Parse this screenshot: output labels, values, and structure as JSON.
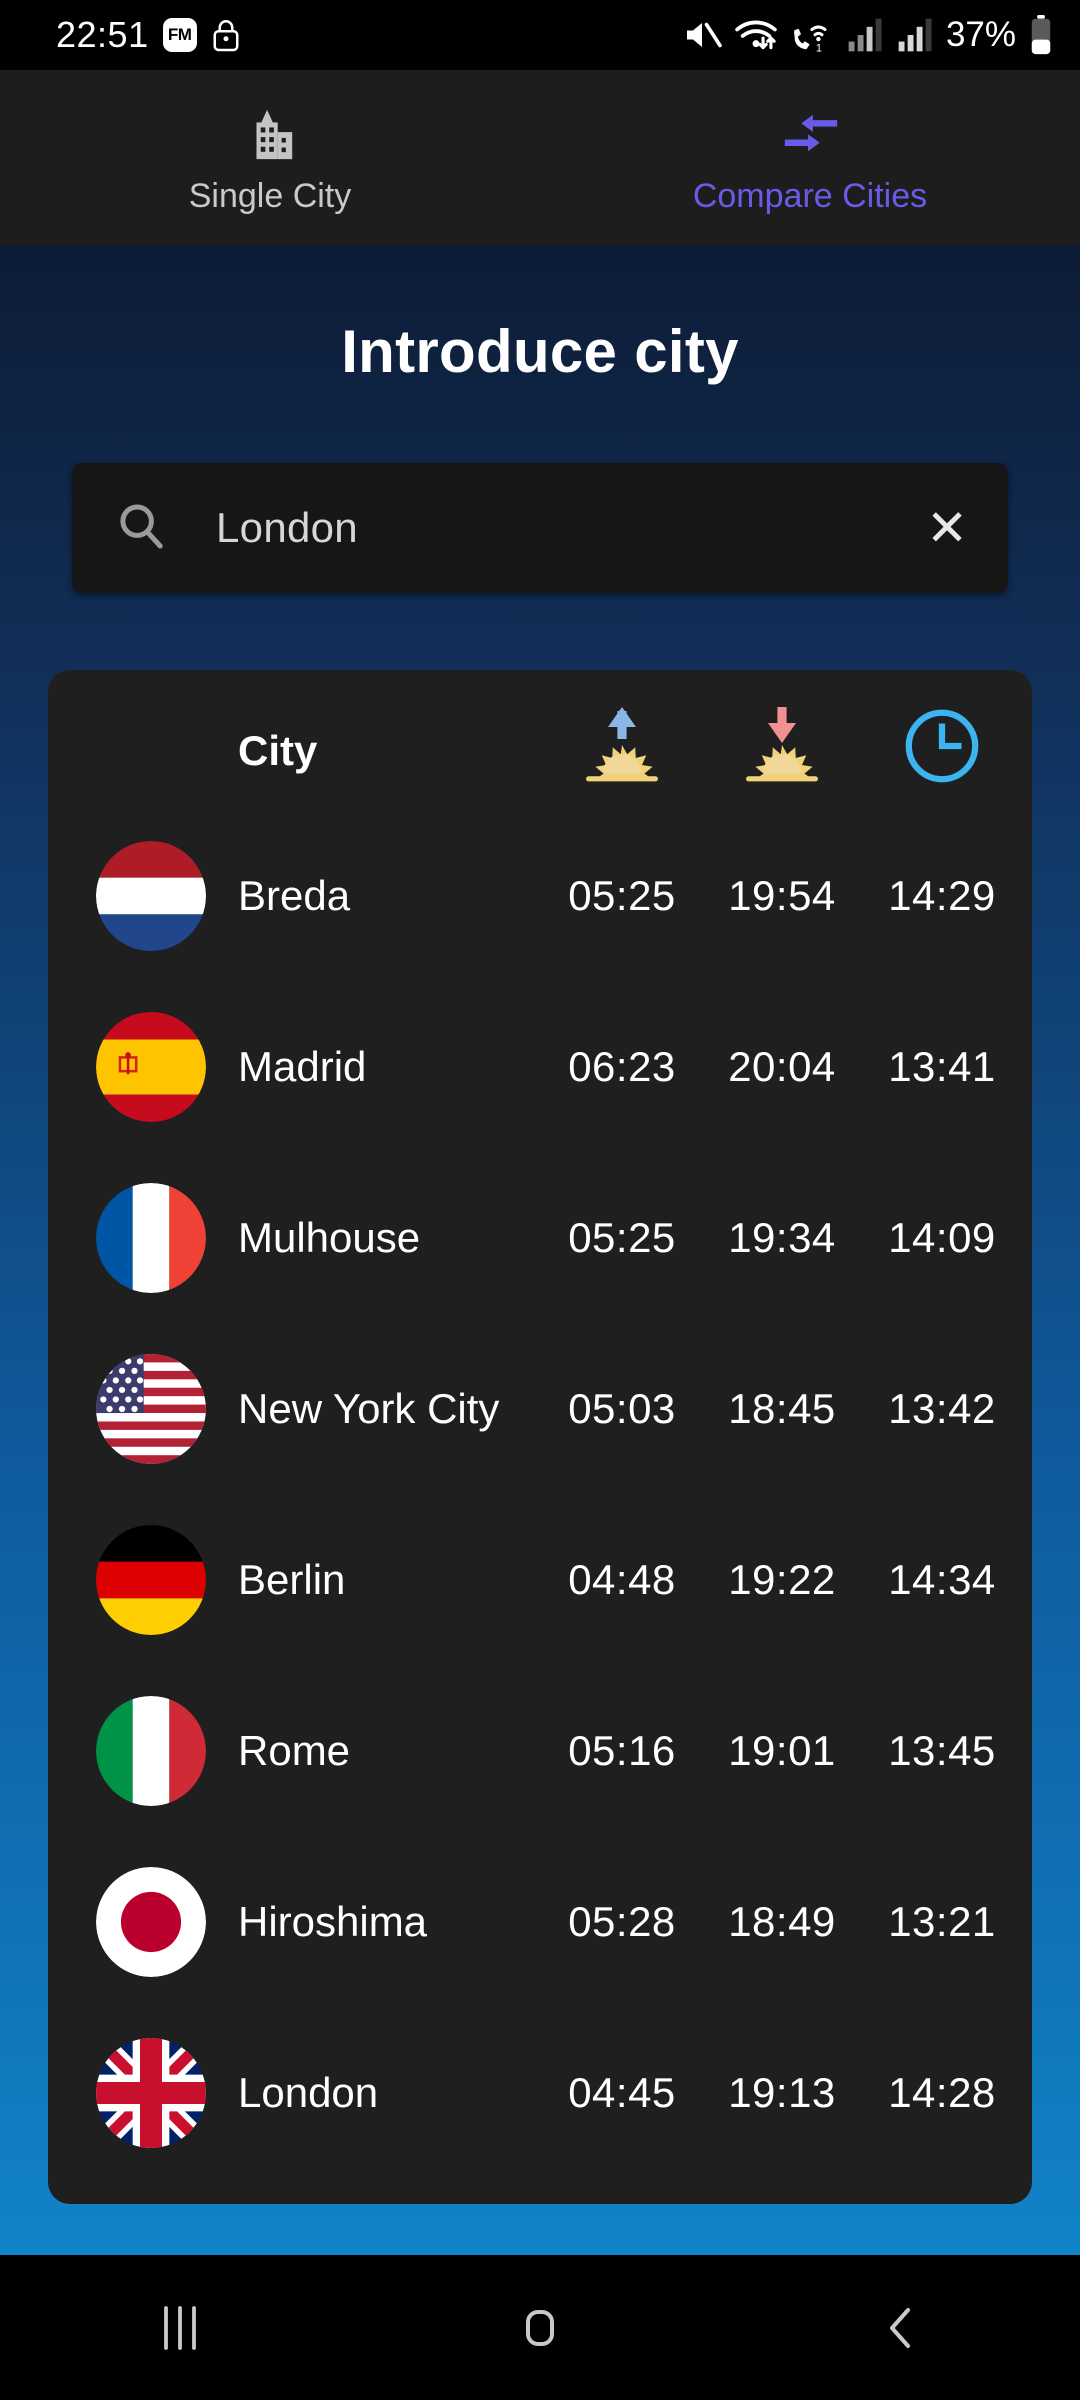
{
  "status_bar": {
    "time": "22:51",
    "fm_badge": "FM",
    "icons_left": [
      "fm-icon",
      "lock-icon"
    ],
    "icons_right": [
      "mute-icon",
      "wifi-icon",
      "wifi-calling-icon",
      "signal-icon-1",
      "signal-icon-2"
    ],
    "battery_percent": "37%"
  },
  "tabs": [
    {
      "label": "Single City",
      "icon": "city-building-icon",
      "active": false
    },
    {
      "label": "Compare Cities",
      "icon": "compare-arrows-icon",
      "active": true
    }
  ],
  "header": {
    "title": "Introduce city"
  },
  "search": {
    "value": "London",
    "placeholder": "Introduce city",
    "icon": "search-icon",
    "clear_icon": "close-icon",
    "clear_label": "✕"
  },
  "table": {
    "columns": [
      {
        "key": "city",
        "label": "City",
        "icon": ""
      },
      {
        "key": "sunrise",
        "label": "",
        "icon": "sunrise-icon"
      },
      {
        "key": "sunset",
        "label": "",
        "icon": "sunset-icon"
      },
      {
        "key": "daylength",
        "label": "",
        "icon": "clock-icon"
      }
    ],
    "rows": [
      {
        "flag": "flag-netherlands",
        "city": "Breda",
        "sunrise": "05:25",
        "sunset": "19:54",
        "daylength": "14:29"
      },
      {
        "flag": "flag-spain",
        "city": "Madrid",
        "sunrise": "06:23",
        "sunset": "20:04",
        "daylength": "13:41"
      },
      {
        "flag": "flag-france",
        "city": "Mulhouse",
        "sunrise": "05:25",
        "sunset": "19:34",
        "daylength": "14:09"
      },
      {
        "flag": "flag-usa",
        "city": "New York City",
        "sunrise": "05:03",
        "sunset": "18:45",
        "daylength": "13:42"
      },
      {
        "flag": "flag-germany",
        "city": "Berlin",
        "sunrise": "04:48",
        "sunset": "19:22",
        "daylength": "14:34"
      },
      {
        "flag": "flag-italy",
        "city": "Rome",
        "sunrise": "05:16",
        "sunset": "19:01",
        "daylength": "13:45"
      },
      {
        "flag": "flag-japan",
        "city": "Hiroshima",
        "sunrise": "05:28",
        "sunset": "18:49",
        "daylength": "13:21"
      },
      {
        "flag": "flag-uk",
        "city": "London",
        "sunrise": "04:45",
        "sunset": "19:13",
        "daylength": "14:28"
      }
    ]
  },
  "nav_bar": {
    "buttons": [
      "recents-button",
      "home-button",
      "back-button"
    ]
  },
  "colors": {
    "accent_purple": "#6a5ae8",
    "clock_cyan": "#3bb4f0",
    "sunrise_arrow_blue": "#8ab6e8",
    "sunset_arrow_red": "#f09090",
    "gradient_top": "#0d1c36",
    "gradient_bottom": "#1183c8",
    "card_bg": "#1f1f1f",
    "search_bg": "#161616",
    "tabbar_bg": "#1d1d1d"
  }
}
